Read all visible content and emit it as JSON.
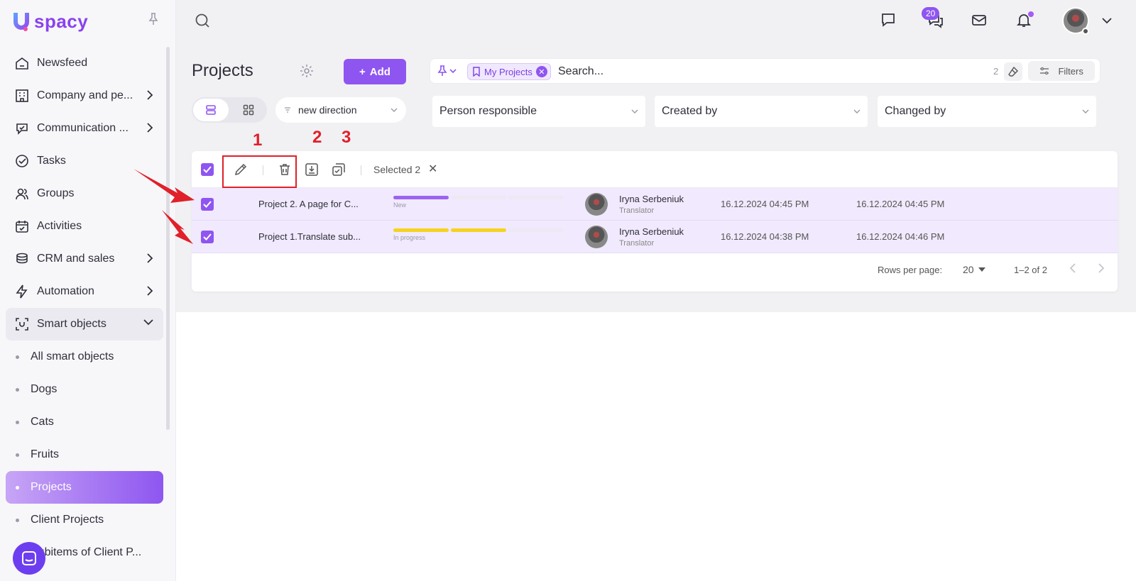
{
  "brand": {
    "logo_text": "spacy",
    "logo_letter": "U",
    "accent": "#8f55f0"
  },
  "sidebar": {
    "items": [
      {
        "label": "Newsfeed",
        "icon": "home-icon"
      },
      {
        "label": "Company and pe...",
        "icon": "building-icon",
        "has_chevron": true
      },
      {
        "label": "Communication ...",
        "icon": "communication-icon",
        "has_chevron": true
      },
      {
        "label": "Tasks",
        "icon": "check-circle-icon"
      },
      {
        "label": "Groups",
        "icon": "users-icon"
      },
      {
        "label": "Activities",
        "icon": "calendar-icon"
      },
      {
        "label": "CRM and sales",
        "icon": "coins-icon",
        "has_chevron": true
      },
      {
        "label": "Automation",
        "icon": "lightning-icon",
        "has_chevron": true
      },
      {
        "label": "Smart objects",
        "icon": "scan-icon",
        "expanded": true
      }
    ],
    "sub_items": [
      {
        "label": "All smart objects"
      },
      {
        "label": "Dogs"
      },
      {
        "label": "Cats"
      },
      {
        "label": "Fruits"
      },
      {
        "label": "Projects",
        "active": true
      },
      {
        "label": "Client Projects"
      },
      {
        "label": "Subitems of Client P..."
      }
    ]
  },
  "topbar": {
    "chat_badge": "20"
  },
  "page": {
    "title": "Projects",
    "add_label": "Add"
  },
  "search": {
    "chip_label": "My Projects",
    "placeholder": "Search...",
    "count": "2",
    "filters_label": "Filters"
  },
  "sort": {
    "label": "new direction"
  },
  "filters": {
    "person": "Person responsible",
    "created": "Created by",
    "changed": "Changed by"
  },
  "bulk": {
    "selected_label": "Selected 2"
  },
  "rows": [
    {
      "name": "Project 2. A page for C...",
      "stage": "New",
      "progress_segments_filled": 1,
      "progress_color": "#9b63f2",
      "user": "Iryna Serbeniuk",
      "role": "Translator",
      "created": "16.12.2024 04:45 PM",
      "changed": "16.12.2024 04:45 PM"
    },
    {
      "name": "Project 1.Translate sub...",
      "stage": "In progress",
      "progress_segments_filled": 2,
      "progress_color": "#f5d31e",
      "user": "Iryna Serbeniuk",
      "role": "Translator",
      "created": "16.12.2024 04:38 PM",
      "changed": "16.12.2024 04:46 PM"
    }
  ],
  "pager": {
    "rows_per_page_label": "Rows per page:",
    "rows_per_page_value": "20",
    "range": "1–2 of 2"
  },
  "annotations": {
    "n1": "1",
    "n2": "2",
    "n3": "3",
    "color": "#e0202a"
  }
}
